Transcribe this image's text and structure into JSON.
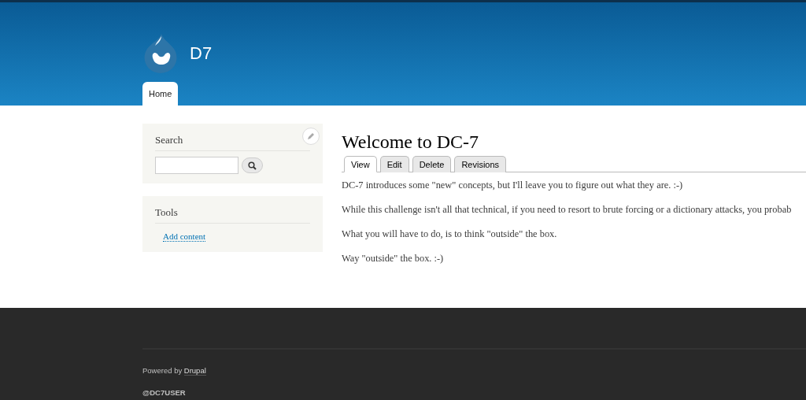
{
  "site_name": "D7",
  "main_menu": [
    {
      "label": "Home",
      "selected": true
    }
  ],
  "sidebar": {
    "search": {
      "title": "Search"
    },
    "tools": {
      "title": "Tools",
      "links": [
        "Add content"
      ]
    }
  },
  "node": {
    "title": "Welcome to DC-7",
    "tabs": [
      {
        "label": "View",
        "selected": true
      },
      {
        "label": "Edit",
        "selected": false
      },
      {
        "label": "Delete",
        "selected": false
      },
      {
        "label": "Revisions",
        "selected": false
      }
    ],
    "paragraphs": [
      "DC-7 introduces some \"new\" concepts, but I'll leave you to figure out what they are.  :-)",
      "While this challenge isn't all that technical, if you need to resort to brute forcing or a dictionary attacks, you probab",
      "What you will have to do, is to think \"outside\" the box.",
      "Way \"outside\" the box.  :-)"
    ]
  },
  "footer": {
    "powered_by": "Powered by",
    "powered_link": "Drupal",
    "text": "@DC7USER"
  }
}
